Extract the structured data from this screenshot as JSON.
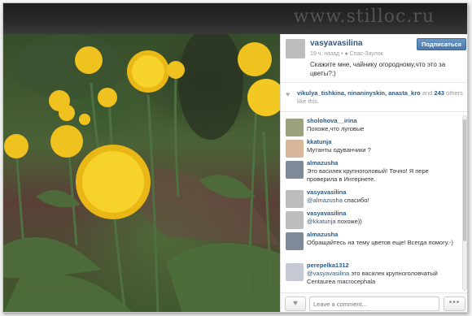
{
  "watermark": "www.stilloc.ru",
  "post": {
    "owner": "vasyavasilina",
    "follow_label": "Подписаться",
    "time_ago": "19 ч. назад",
    "location": "Спас-Заулок",
    "caption": "Скажите мне, чайнику огородному,что это за цветы?:)"
  },
  "likes": {
    "names": "vikulya_tishkina, ninaninyskin, anasta_kro",
    "and_label": "and",
    "others_count": "243",
    "suffix": "others like this."
  },
  "comments": [
    {
      "user": "sholohova__irina",
      "text": "Похоже,что луговые"
    },
    {
      "user": "kkatunja",
      "text": "Мутанты одуванчики ?"
    },
    {
      "user": "almazusha",
      "text": "Это василек крупноголовый! Точно! Я пере проверила в Интернете."
    },
    {
      "user": "vasyavasilina",
      "mention": "@almazusha",
      "text": "спасибо!"
    },
    {
      "user": "vasyavasilina",
      "mention": "@kkatunja",
      "text": "похоже))"
    },
    {
      "user": "almazusha",
      "text": "Обращайтесь на тему цветов еще! Всегда помогу.-)"
    },
    {
      "user": "perepelka1312",
      "mention": "@vasyavasilina",
      "text": "это василек крупноголовчатый Centaurea macrocephala"
    }
  ],
  "composer": {
    "placeholder": "Leave a comment...",
    "more_label": "•••"
  },
  "colors": {
    "link": "#2c5a85",
    "follow_button": "#4a79aa",
    "flower": "#f2c81b"
  },
  "icons": {
    "heart": "heart-icon",
    "pin": "location-pin-icon",
    "more": "more-icon"
  }
}
